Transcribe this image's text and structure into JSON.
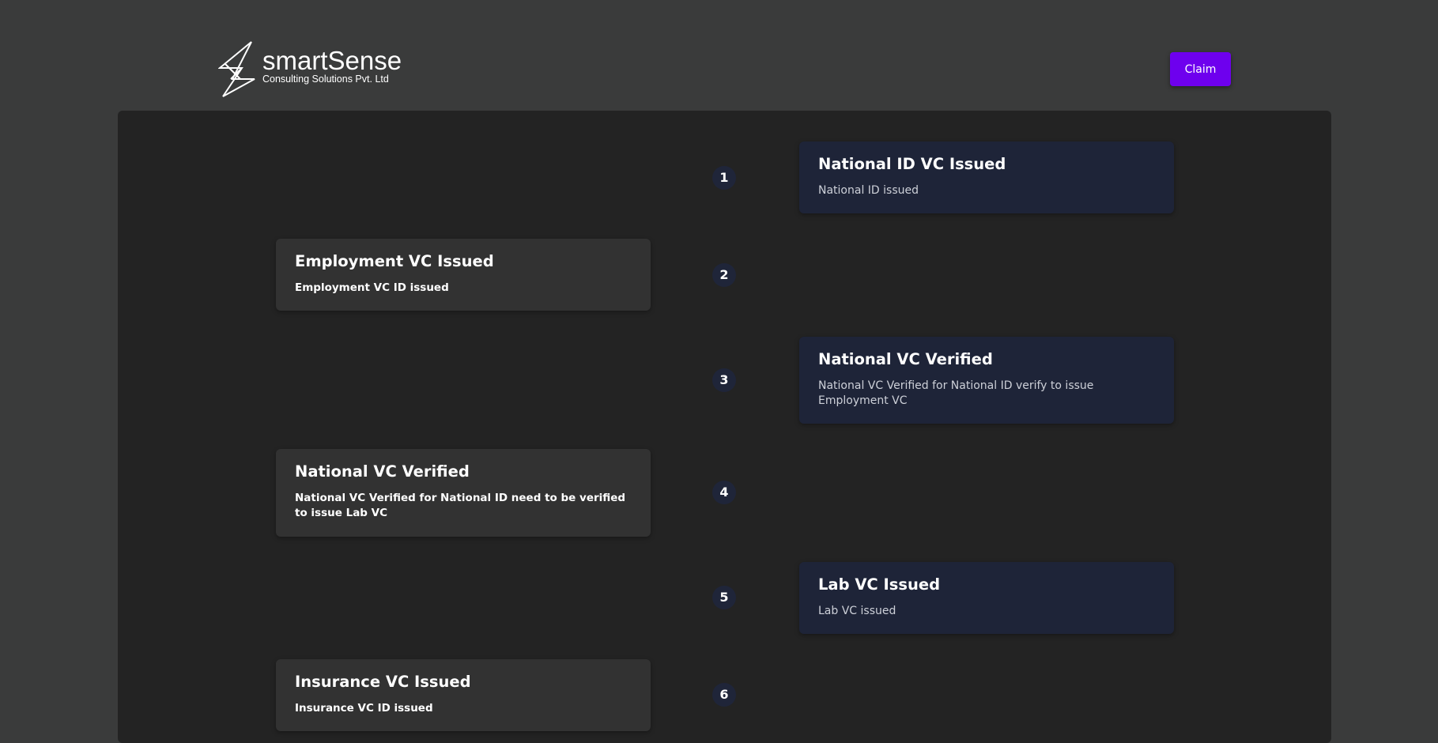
{
  "brand": {
    "name": "smartSense",
    "tagline": "Consulting Solutions Pvt. Ltd"
  },
  "header": {
    "claim_label": "Claim"
  },
  "colors": {
    "page_bg": "#3a3b3b",
    "panel_bg": "#232323",
    "left_card_bg": "#323232",
    "right_card_bg": "#1e2438",
    "accent": "#6e00ee",
    "step_badge_bg": "#1f2539"
  },
  "timeline": [
    {
      "step": "1",
      "side": "right",
      "title": "National ID VC Issued",
      "description": "National ID issued"
    },
    {
      "step": "2",
      "side": "left",
      "title": "Employment VC Issued",
      "description": "Employment VC ID issued"
    },
    {
      "step": "3",
      "side": "right",
      "title": "National VC Verified",
      "description": "National VC Verified for National ID verify to issue Employment VC"
    },
    {
      "step": "4",
      "side": "left",
      "title": "National VC Verified",
      "description": "National VC Verified for National ID need to be verified to issue Lab VC"
    },
    {
      "step": "5",
      "side": "right",
      "title": "Lab VC Issued",
      "description": "Lab VC issued"
    },
    {
      "step": "6",
      "side": "left",
      "title": "Insurance VC Issued",
      "description": "Insurance VC ID issued"
    }
  ]
}
